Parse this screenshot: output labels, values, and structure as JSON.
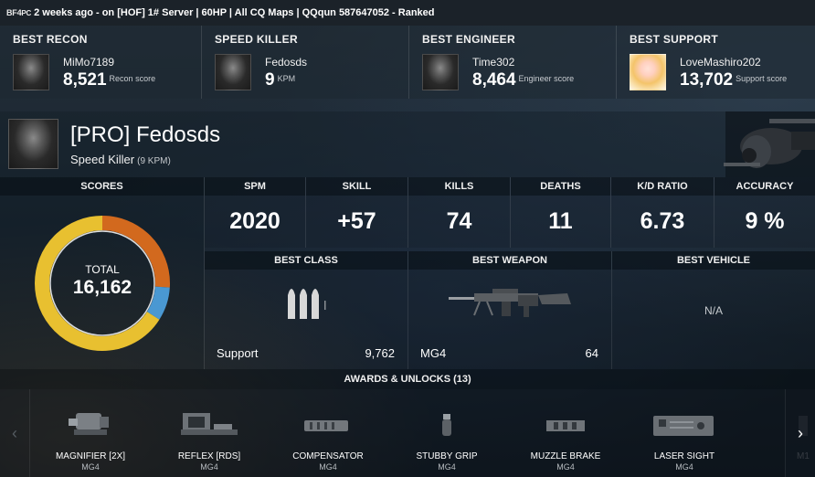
{
  "topbar": {
    "logo_text": "BF4",
    "logo_platform": "PC",
    "info": "2 weeks ago - on [HOF] 1# Server | 60HP | All CQ Maps | QQqun 587647052 - Ranked"
  },
  "best_players": [
    {
      "title": "BEST RECON",
      "name": "MiMo7189",
      "value": "8,521",
      "unit": "Recon score",
      "avatar": "soldier-avatar"
    },
    {
      "title": "SPEED KILLER",
      "name": "Fedosds",
      "value": "9",
      "unit": "KPM",
      "avatar": "soldier-avatar"
    },
    {
      "title": "BEST ENGINEER",
      "name": "Time302",
      "value": "8,464",
      "unit": "Engineer score",
      "avatar": "soldier-avatar"
    },
    {
      "title": "BEST SUPPORT",
      "name": "LoveMashiro202",
      "value": "13,702",
      "unit": "Support score",
      "avatar": "anime-avatar"
    }
  ],
  "profile": {
    "name": "[PRO] Fedosds",
    "award": "Speed Killer",
    "award_detail": "(9 KPM)",
    "vehicle_icon": "helicopter-icon"
  },
  "scores": {
    "header": "SCORES",
    "total_label": "TOTAL",
    "total_value": "16,162",
    "segments": [
      {
        "fraction": 0.26,
        "color": "#d2691e"
      },
      {
        "fraction": 0.08,
        "color": "#4a98d2"
      },
      {
        "fraction": 0.66,
        "color": "#e8c030"
      }
    ]
  },
  "stats": [
    {
      "label": "SPM",
      "value": "2020"
    },
    {
      "label": "SKILL",
      "value": "+57"
    },
    {
      "label": "KILLS",
      "value": "74"
    },
    {
      "label": "DEATHS",
      "value": "11"
    },
    {
      "label": "K/D RATIO",
      "value": "6.73"
    },
    {
      "label": "ACCURACY",
      "value": "9 %"
    }
  ],
  "best_class": {
    "header": "BEST CLASS",
    "name": "Support",
    "score": "9,762",
    "icon": "ammo-icon"
  },
  "best_weapon": {
    "header": "BEST WEAPON",
    "name": "MG4",
    "score": "64",
    "icon": "machine-gun-icon"
  },
  "best_vehicle": {
    "header": "BEST VEHICLE",
    "value": "N/A"
  },
  "awards": {
    "header": "AWARDS & UNLOCKS (13)",
    "prev_icon": "chevron-left-icon",
    "next_icon": "chevron-right-icon",
    "items": [
      {
        "name": "MAGNIFIER [2X]",
        "weapon": "MG4",
        "icon": "magnifier-scope-icon"
      },
      {
        "name": "REFLEX [RDS]",
        "weapon": "MG4",
        "icon": "reflex-sight-icon"
      },
      {
        "name": "COMPENSATOR",
        "weapon": "MG4",
        "icon": "compensator-icon"
      },
      {
        "name": "STUBBY GRIP",
        "weapon": "MG4",
        "icon": "stubby-grip-icon"
      },
      {
        "name": "MUZZLE BRAKE",
        "weapon": "MG4",
        "icon": "muzzle-brake-icon"
      },
      {
        "name": "LASER SIGHT",
        "weapon": "MG4",
        "icon": "laser-sight-icon"
      },
      {
        "name": "M1",
        "weapon": "",
        "icon": "attachment-icon"
      }
    ]
  }
}
